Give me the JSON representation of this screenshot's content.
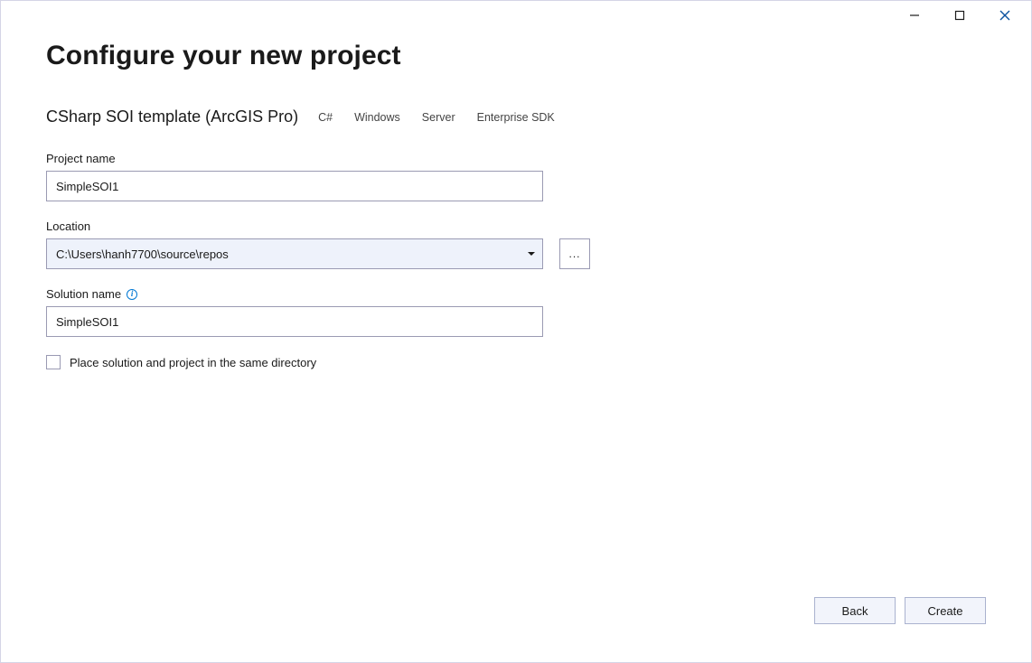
{
  "window": {
    "heading": "Configure your new project",
    "template_name": "CSharp SOI template (ArcGIS Pro)",
    "tags": [
      "C#",
      "Windows",
      "Server",
      "Enterprise SDK"
    ]
  },
  "fields": {
    "project_name": {
      "label": "Project name",
      "value": "SimpleSOI1"
    },
    "location": {
      "label": "Location",
      "value": "C:\\Users\\hanh7700\\source\\repos",
      "browse_label": "..."
    },
    "solution_name": {
      "label": "Solution name",
      "value": "SimpleSOI1"
    },
    "same_dir_checkbox": {
      "label": "Place solution and project in the same directory",
      "checked": false
    }
  },
  "footer": {
    "back": "Back",
    "create": "Create"
  }
}
